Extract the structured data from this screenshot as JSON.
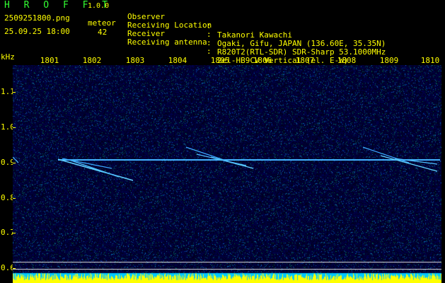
{
  "header": {
    "app_name": "H R O F F T",
    "app_version": "1.0.0",
    "file_name": "2509251800.png",
    "date_time": "25.09.25 18:00",
    "meteor_label": "meteor",
    "meteor_count": "42"
  },
  "info": [
    {
      "key": "Observer",
      "sep": ":",
      "value": "Takanori Kawachi"
    },
    {
      "key": "Receiving Location",
      "sep": ":",
      "value": "Ogaki, Gifu, JAPAN (136.60E, 35.35N)"
    },
    {
      "key": "Receiver",
      "sep": ":",
      "value": "R820T2(RTL-SDR) SDR-Sharp 53.1000MHz"
    },
    {
      "key": "Receiving antenna",
      "sep": ":",
      "value": "2el-HB9CV Vertical (el. E-W)"
    }
  ],
  "axes": {
    "unit": "kHz",
    "time_ticks": [
      "1801",
      "1802",
      "1803",
      "1804",
      "1805",
      "1806",
      "1807",
      "1808",
      "1809",
      "1810"
    ],
    "freq_ticks": [
      "1.1",
      "1.0",
      "0.9",
      "0.8",
      "0.7",
      "0.6"
    ]
  },
  "colors": {
    "header_green": "#33ff33",
    "label_yellow": "#ffff00",
    "background": "#05051e",
    "activity_yellow": "#ffff00",
    "activity_cyan": "#00c8ff"
  }
}
